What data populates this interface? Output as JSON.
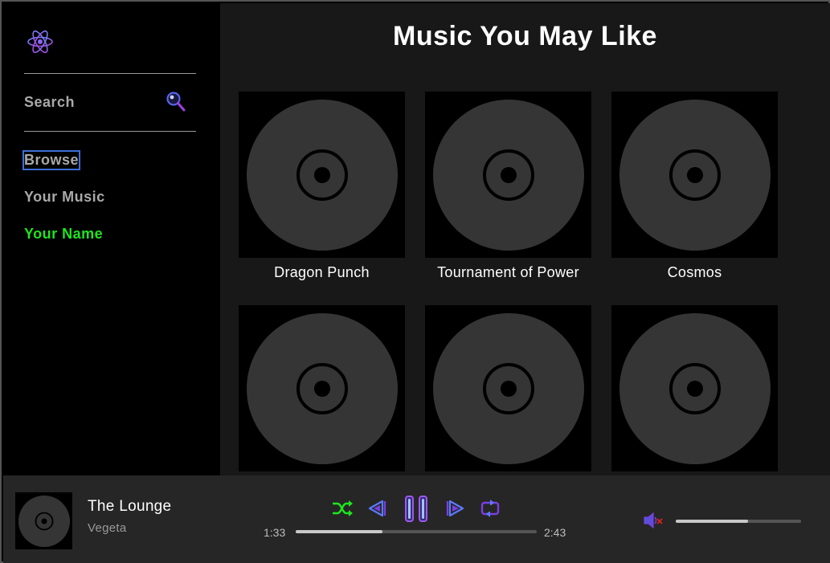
{
  "sidebar": {
    "logo_icon": "atom-icon",
    "search_label": "Search",
    "search_icon": "search-icon",
    "nav": [
      {
        "label": "Browse",
        "active": true
      },
      {
        "label": "Your Music"
      },
      {
        "label": "Your Name",
        "color": "#1ee61e"
      }
    ]
  },
  "main": {
    "title": "Music You May Like",
    "cards": [
      {
        "title": "Dragon Punch"
      },
      {
        "title": "Tournament of Power"
      },
      {
        "title": "Cosmos"
      },
      {
        "title": ""
      },
      {
        "title": ""
      },
      {
        "title": ""
      }
    ]
  },
  "player": {
    "now_playing": {
      "title": "The Lounge",
      "artist": "Vegeta"
    },
    "controls": [
      "shuffle-icon",
      "previous-icon",
      "pause-icon",
      "next-icon",
      "repeat-icon"
    ],
    "elapsed": "1:33",
    "duration": "2:43",
    "progress_fraction": 0.36,
    "volume_icon": "volume-muted-icon",
    "volume_fraction": 0.58
  },
  "colors": {
    "accent_purple": "#7b3fe4",
    "accent_blue": "#5a7bff",
    "accent_green": "#1ee61e",
    "mute_red": "#e02020"
  }
}
